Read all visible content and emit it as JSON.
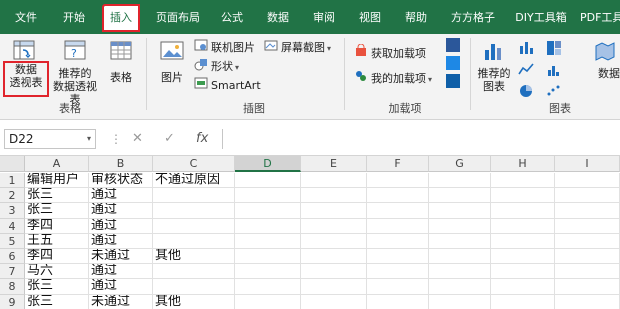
{
  "tabs": [
    "文件",
    "开始",
    "插入",
    "页面布局",
    "公式",
    "数据",
    "审阅",
    "视图",
    "帮助",
    "方方格子",
    "DIY工具箱",
    "PDF工具"
  ],
  "ribbon": {
    "tables_group": {
      "label": "表格",
      "pivot_table_line1": "数据",
      "pivot_table_line2": "透视表",
      "recommended_pivot_line1": "推荐的",
      "recommended_pivot_line2": "数据透视表",
      "table": "表格"
    },
    "illustrations_group": {
      "label": "插图",
      "pictures": "图片",
      "online_pictures": "联机图片",
      "shapes": "形状",
      "smartart": "SmartArt",
      "screenshot": "屏幕截图"
    },
    "addins_group": {
      "label": "加载项",
      "get_addins": "获取加载项",
      "my_addins": "我的加载项"
    },
    "charts_group": {
      "label": "图表",
      "recommended_charts_line1": "推荐的",
      "recommended_charts_line2": "图表",
      "maps_partial": "数据"
    }
  },
  "formula_bar": {
    "name_box": "D22",
    "cancel_icon": "✕",
    "enter_icon": "✓",
    "fx_icon": "fx",
    "value": ""
  },
  "sheet": {
    "columns": [
      "A",
      "B",
      "C",
      "D",
      "E",
      "F",
      "G",
      "H",
      "I"
    ],
    "selected_column": "D",
    "rows": [
      {
        "num": "1",
        "a": "编辑用户",
        "b": "审核状态",
        "c": "不通过原因"
      },
      {
        "num": "2",
        "a": "张三",
        "b": "通过",
        "c": ""
      },
      {
        "num": "3",
        "a": "张三",
        "b": "通过",
        "c": ""
      },
      {
        "num": "4",
        "a": "李四",
        "b": "通过",
        "c": ""
      },
      {
        "num": "5",
        "a": "王五",
        "b": "通过",
        "c": ""
      },
      {
        "num": "6",
        "a": "李四",
        "b": "未通过",
        "c": "其他"
      },
      {
        "num": "7",
        "a": "马六",
        "b": "通过",
        "c": ""
      },
      {
        "num": "8",
        "a": "张三",
        "b": "通过",
        "c": ""
      },
      {
        "num": "9",
        "a": "张三",
        "b": "未通过",
        "c": "其他"
      }
    ]
  },
  "colors": {
    "excel_green": "#217346",
    "highlight_red": "#e0242c"
  }
}
